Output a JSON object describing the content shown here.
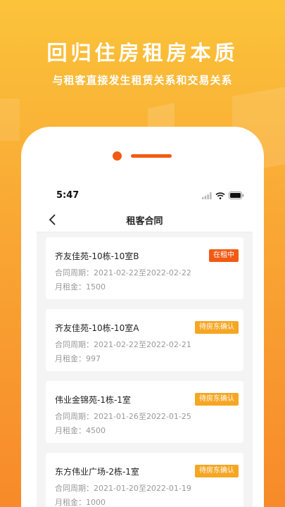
{
  "promo": {
    "headline": "回归住房租房本质",
    "subline": "与租客直接发生租赁关系和交易关系"
  },
  "status": {
    "time": "5:47"
  },
  "nav": {
    "title": "租客合同"
  },
  "labels": {
    "period_prefix": "合同周期：",
    "period_sep": "至",
    "rent_prefix": "月租金："
  },
  "contracts": [
    {
      "title": "齐友佳苑-10栋-10室B",
      "start": "2021-02-22",
      "end": "2022-02-22",
      "rent": "1500",
      "status": "在租中",
      "status_color": "#f25a14"
    },
    {
      "title": "齐友佳苑-10栋-10室A",
      "start": "2021-02-22",
      "end": "2022-02-21",
      "rent": "997",
      "status": "待房东确认",
      "status_color": "#f5a623"
    },
    {
      "title": "伟业金锦苑-1栋-1室",
      "start": "2021-01-26",
      "end": "2022-01-25",
      "rent": "4500",
      "status": "待房东确认",
      "status_color": "#f5a623"
    },
    {
      "title": "东方伟业广场-2栋-1室",
      "start": "2021-01-20",
      "end": "2022-01-19",
      "rent": "1000",
      "status": "待房东确认",
      "status_color": "#f5a623"
    }
  ],
  "colors": {
    "accent": "#f25a14",
    "pending": "#f5a623",
    "background_top": "#fbc33a",
    "background_bottom": "#f78a2a"
  },
  "icons": [
    "chevron-left-icon",
    "signal-icon",
    "wifi-icon",
    "battery-icon"
  ]
}
